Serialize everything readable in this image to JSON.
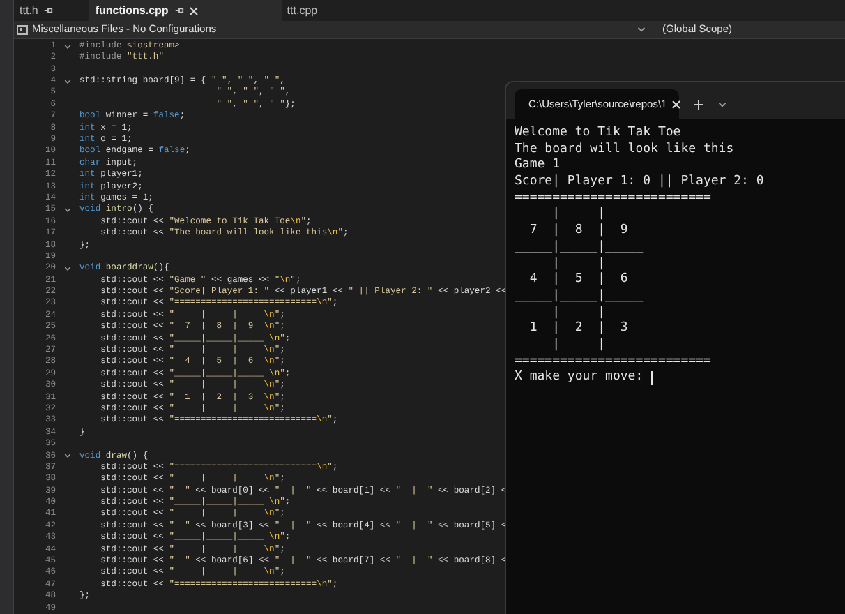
{
  "editor_tabs": [
    {
      "label": "ttt.h",
      "selected": false,
      "pinned": true,
      "closable": false
    },
    {
      "label": "functions.cpp",
      "selected": true,
      "pinned": true,
      "closable": true
    },
    {
      "label": "ttt.cpp",
      "selected": false,
      "pinned": false,
      "closable": false
    }
  ],
  "nav_bar": {
    "project": "Miscellaneous Files - No Configurations",
    "scope": "(Global Scope)"
  },
  "code_lines": [
    {
      "number": "1",
      "fold": true,
      "tokens": [
        {
          "kind": "pp",
          "text": "#include "
        },
        {
          "kind": "str",
          "text": "<iostream>"
        }
      ]
    },
    {
      "number": "2",
      "fold": false,
      "tokens": [
        {
          "kind": "pp",
          "text": "#include "
        },
        {
          "kind": "str",
          "text": "\"ttt.h\""
        }
      ]
    },
    {
      "number": "3",
      "fold": false
    },
    {
      "number": "4",
      "fold": true,
      "tokens": [
        {
          "kind": "plain",
          "text": "std::string board[9] = { "
        },
        {
          "kind": "str",
          "text": "\" \""
        },
        {
          "kind": "plain",
          "text": ", "
        },
        {
          "kind": "str",
          "text": "\" \""
        },
        {
          "kind": "plain",
          "text": ", "
        },
        {
          "kind": "str",
          "text": "\" \""
        },
        {
          "kind": "plain",
          "text": ","
        }
      ]
    },
    {
      "number": "5",
      "fold": false,
      "tokens": [
        {
          "kind": "str",
          "text": "                          \" \""
        },
        {
          "kind": "plain",
          "text": ", "
        },
        {
          "kind": "str",
          "text": "\" \""
        },
        {
          "kind": "plain",
          "text": ", "
        },
        {
          "kind": "str",
          "text": "\" \""
        },
        {
          "kind": "plain",
          "text": ","
        }
      ]
    },
    {
      "number": "6",
      "fold": false,
      "tokens": [
        {
          "kind": "str",
          "text": "                          \" \""
        },
        {
          "kind": "plain",
          "text": ", "
        },
        {
          "kind": "str",
          "text": "\" \""
        },
        {
          "kind": "plain",
          "text": ", "
        },
        {
          "kind": "str",
          "text": "\" \""
        },
        {
          "kind": "plain",
          "text": "};"
        }
      ]
    },
    {
      "number": "7",
      "fold": false,
      "tokens": [
        {
          "kind": "kw",
          "text": "bool"
        },
        {
          "kind": "plain",
          "text": " winner = "
        },
        {
          "kind": "kw",
          "text": "false"
        },
        {
          "kind": "plain",
          "text": ";"
        }
      ]
    },
    {
      "number": "8",
      "fold": false,
      "tokens": [
        {
          "kind": "kw",
          "text": "int"
        },
        {
          "kind": "plain",
          "text": " x = 1;"
        }
      ]
    },
    {
      "number": "9",
      "fold": false,
      "tokens": [
        {
          "kind": "kw",
          "text": "int"
        },
        {
          "kind": "plain",
          "text": " o = 1;"
        }
      ]
    },
    {
      "number": "10",
      "fold": false,
      "tokens": [
        {
          "kind": "kw",
          "text": "bool"
        },
        {
          "kind": "plain",
          "text": " endgame = "
        },
        {
          "kind": "kw",
          "text": "false"
        },
        {
          "kind": "plain",
          "text": ";"
        }
      ]
    },
    {
      "number": "11",
      "fold": false,
      "tokens": [
        {
          "kind": "kw",
          "text": "char"
        },
        {
          "kind": "plain",
          "text": " input;"
        }
      ]
    },
    {
      "number": "12",
      "fold": false,
      "tokens": [
        {
          "kind": "kw",
          "text": "int"
        },
        {
          "kind": "plain",
          "text": " player1;"
        }
      ]
    },
    {
      "number": "13",
      "fold": false,
      "tokens": [
        {
          "kind": "kw",
          "text": "int"
        },
        {
          "kind": "plain",
          "text": " player2;"
        }
      ]
    },
    {
      "number": "14",
      "fold": false,
      "tokens": [
        {
          "kind": "kw",
          "text": "int"
        },
        {
          "kind": "plain",
          "text": " games = 1;"
        }
      ]
    },
    {
      "number": "15",
      "fold": true,
      "tokens": [
        {
          "kind": "kw",
          "text": "void"
        },
        {
          "kind": "fn",
          "text": " intro"
        },
        {
          "kind": "plain",
          "text": "() {"
        }
      ]
    },
    {
      "number": "16",
      "fold": false,
      "tokens": [
        {
          "kind": "plain",
          "text": "    std::cout << "
        },
        {
          "kind": "str",
          "text": "\"Welcome to Tik Tak Toe"
        },
        {
          "kind": "esc",
          "text": "\\n"
        },
        {
          "kind": "str",
          "text": "\""
        },
        {
          "kind": "plain",
          "text": ";"
        }
      ]
    },
    {
      "number": "17",
      "fold": false,
      "tokens": [
        {
          "kind": "plain",
          "text": "    std::cout << "
        },
        {
          "kind": "str",
          "text": "\"The board will look like this"
        },
        {
          "kind": "esc",
          "text": "\\n"
        },
        {
          "kind": "str",
          "text": "\""
        },
        {
          "kind": "plain",
          "text": ";"
        }
      ]
    },
    {
      "number": "18",
      "fold": false,
      "tokens": [
        {
          "kind": "plain",
          "text": "};"
        }
      ]
    },
    {
      "number": "19",
      "fold": false
    },
    {
      "number": "20",
      "fold": true,
      "tokens": [
        {
          "kind": "kw",
          "text": "void"
        },
        {
          "kind": "fn",
          "text": " boarddraw"
        },
        {
          "kind": "plain",
          "text": "(){"
        }
      ]
    },
    {
      "number": "21",
      "fold": false,
      "tokens": [
        {
          "kind": "plain",
          "text": "    std::cout << "
        },
        {
          "kind": "str",
          "text": "\"Game \""
        },
        {
          "kind": "plain",
          "text": " << games << "
        },
        {
          "kind": "str",
          "text": "\""
        },
        {
          "kind": "esc",
          "text": "\\n"
        },
        {
          "kind": "str",
          "text": "\""
        },
        {
          "kind": "plain",
          "text": ";"
        }
      ]
    },
    {
      "number": "22",
      "fold": false,
      "tokens": [
        {
          "kind": "plain",
          "text": "    std::cout << "
        },
        {
          "kind": "str",
          "text": "\"Score| Player 1: \""
        },
        {
          "kind": "plain",
          "text": " << player1 << "
        },
        {
          "kind": "str",
          "text": "\" || Player 2: \""
        },
        {
          "kind": "plain",
          "text": " << player2 <<"
        }
      ]
    },
    {
      "number": "23",
      "fold": false,
      "tokens": [
        {
          "kind": "plain",
          "text": "    std::cout << "
        },
        {
          "kind": "str",
          "text": "\"==========================="
        },
        {
          "kind": "esc",
          "text": "\\n"
        },
        {
          "kind": "str",
          "text": "\""
        },
        {
          "kind": "plain",
          "text": ";"
        }
      ]
    },
    {
      "number": "24",
      "fold": false,
      "tokens": [
        {
          "kind": "plain",
          "text": "    std::cout << "
        },
        {
          "kind": "str",
          "text": "\"     |     |     "
        },
        {
          "kind": "esc",
          "text": "\\n"
        },
        {
          "kind": "str",
          "text": "\""
        },
        {
          "kind": "plain",
          "text": ";"
        }
      ]
    },
    {
      "number": "25",
      "fold": false,
      "tokens": [
        {
          "kind": "plain",
          "text": "    std::cout << "
        },
        {
          "kind": "str",
          "text": "\"  7  |  8  |  9  "
        },
        {
          "kind": "esc",
          "text": "\\n"
        },
        {
          "kind": "str",
          "text": "\""
        },
        {
          "kind": "plain",
          "text": ";"
        }
      ]
    },
    {
      "number": "26",
      "fold": false,
      "tokens": [
        {
          "kind": "plain",
          "text": "    std::cout << "
        },
        {
          "kind": "str",
          "text": "\"_____|_____|_____ "
        },
        {
          "kind": "esc",
          "text": "\\n"
        },
        {
          "kind": "str",
          "text": "\""
        },
        {
          "kind": "plain",
          "text": ";"
        }
      ]
    },
    {
      "number": "27",
      "fold": false,
      "tokens": [
        {
          "kind": "plain",
          "text": "    std::cout << "
        },
        {
          "kind": "str",
          "text": "\"     |     |     "
        },
        {
          "kind": "esc",
          "text": "\\n"
        },
        {
          "kind": "str",
          "text": "\""
        },
        {
          "kind": "plain",
          "text": ";"
        }
      ]
    },
    {
      "number": "28",
      "fold": false,
      "tokens": [
        {
          "kind": "plain",
          "text": "    std::cout << "
        },
        {
          "kind": "str",
          "text": "\"  4  |  5  |  6  "
        },
        {
          "kind": "esc",
          "text": "\\n"
        },
        {
          "kind": "str",
          "text": "\""
        },
        {
          "kind": "plain",
          "text": ";"
        }
      ]
    },
    {
      "number": "29",
      "fold": false,
      "tokens": [
        {
          "kind": "plain",
          "text": "    std::cout << "
        },
        {
          "kind": "str",
          "text": "\"_____|_____|_____ "
        },
        {
          "kind": "esc",
          "text": "\\n"
        },
        {
          "kind": "str",
          "text": "\""
        },
        {
          "kind": "plain",
          "text": ";"
        }
      ]
    },
    {
      "number": "30",
      "fold": false,
      "tokens": [
        {
          "kind": "plain",
          "text": "    std::cout << "
        },
        {
          "kind": "str",
          "text": "\"     |     |     "
        },
        {
          "kind": "esc",
          "text": "\\n"
        },
        {
          "kind": "str",
          "text": "\""
        },
        {
          "kind": "plain",
          "text": ";"
        }
      ]
    },
    {
      "number": "31",
      "fold": false,
      "tokens": [
        {
          "kind": "plain",
          "text": "    std::cout << "
        },
        {
          "kind": "str",
          "text": "\"  1  |  2  |  3  "
        },
        {
          "kind": "esc",
          "text": "\\n"
        },
        {
          "kind": "str",
          "text": "\""
        },
        {
          "kind": "plain",
          "text": ";"
        }
      ]
    },
    {
      "number": "32",
      "fold": false,
      "tokens": [
        {
          "kind": "plain",
          "text": "    std::cout << "
        },
        {
          "kind": "str",
          "text": "\"     |     |     "
        },
        {
          "kind": "esc",
          "text": "\\n"
        },
        {
          "kind": "str",
          "text": "\""
        },
        {
          "kind": "plain",
          "text": ";"
        }
      ]
    },
    {
      "number": "33",
      "fold": false,
      "tokens": [
        {
          "kind": "plain",
          "text": "    std::cout << "
        },
        {
          "kind": "str",
          "text": "\"==========================="
        },
        {
          "kind": "esc",
          "text": "\\n"
        },
        {
          "kind": "str",
          "text": "\""
        },
        {
          "kind": "plain",
          "text": ";"
        }
      ]
    },
    {
      "number": "34",
      "fold": false,
      "tokens": [
        {
          "kind": "plain",
          "text": "}"
        }
      ]
    },
    {
      "number": "35",
      "fold": false
    },
    {
      "number": "36",
      "fold": true,
      "tokens": [
        {
          "kind": "kw",
          "text": "void"
        },
        {
          "kind": "fn",
          "text": " draw"
        },
        {
          "kind": "plain",
          "text": "() {"
        }
      ]
    },
    {
      "number": "37",
      "fold": false,
      "tokens": [
        {
          "kind": "plain",
          "text": "    std::cout << "
        },
        {
          "kind": "str",
          "text": "\"==========================="
        },
        {
          "kind": "esc",
          "text": "\\n"
        },
        {
          "kind": "str",
          "text": "\""
        },
        {
          "kind": "plain",
          "text": ";"
        }
      ]
    },
    {
      "number": "38",
      "fold": false,
      "tokens": [
        {
          "kind": "plain",
          "text": "    std::cout << "
        },
        {
          "kind": "str",
          "text": "\"     |     |     "
        },
        {
          "kind": "esc",
          "text": "\\n"
        },
        {
          "kind": "str",
          "text": "\""
        },
        {
          "kind": "plain",
          "text": ";"
        }
      ]
    },
    {
      "number": "39",
      "fold": false,
      "tokens": [
        {
          "kind": "plain",
          "text": "    std::cout << "
        },
        {
          "kind": "str",
          "text": "\"  \""
        },
        {
          "kind": "plain",
          "text": " << board[0] << "
        },
        {
          "kind": "str",
          "text": "\"  |  \""
        },
        {
          "kind": "plain",
          "text": " << board[1] << "
        },
        {
          "kind": "str",
          "text": "\"  |  \""
        },
        {
          "kind": "plain",
          "text": " << board[2] <"
        }
      ]
    },
    {
      "number": "40",
      "fold": false,
      "tokens": [
        {
          "kind": "plain",
          "text": "    std::cout << "
        },
        {
          "kind": "str",
          "text": "\"_____|_____|_____ "
        },
        {
          "kind": "esc",
          "text": "\\n"
        },
        {
          "kind": "str",
          "text": "\""
        },
        {
          "kind": "plain",
          "text": ";"
        }
      ]
    },
    {
      "number": "41",
      "fold": false,
      "tokens": [
        {
          "kind": "plain",
          "text": "    std::cout << "
        },
        {
          "kind": "str",
          "text": "\"     |     |     "
        },
        {
          "kind": "esc",
          "text": "\\n"
        },
        {
          "kind": "str",
          "text": "\""
        },
        {
          "kind": "plain",
          "text": ";"
        }
      ]
    },
    {
      "number": "42",
      "fold": false,
      "tokens": [
        {
          "kind": "plain",
          "text": "    std::cout << "
        },
        {
          "kind": "str",
          "text": "\"  \""
        },
        {
          "kind": "plain",
          "text": " << board[3] << "
        },
        {
          "kind": "str",
          "text": "\"  |  \""
        },
        {
          "kind": "plain",
          "text": " << board[4] << "
        },
        {
          "kind": "str",
          "text": "\"  |  \""
        },
        {
          "kind": "plain",
          "text": " << board[5] <"
        }
      ]
    },
    {
      "number": "43",
      "fold": false,
      "tokens": [
        {
          "kind": "plain",
          "text": "    std::cout << "
        },
        {
          "kind": "str",
          "text": "\"_____|_____|_____ "
        },
        {
          "kind": "esc",
          "text": "\\n"
        },
        {
          "kind": "str",
          "text": "\""
        },
        {
          "kind": "plain",
          "text": ";"
        }
      ]
    },
    {
      "number": "44",
      "fold": false,
      "tokens": [
        {
          "kind": "plain",
          "text": "    std::cout << "
        },
        {
          "kind": "str",
          "text": "\"     |     |     "
        },
        {
          "kind": "esc",
          "text": "\\n"
        },
        {
          "kind": "str",
          "text": "\""
        },
        {
          "kind": "plain",
          "text": ";"
        }
      ]
    },
    {
      "number": "45",
      "fold": false,
      "tokens": [
        {
          "kind": "plain",
          "text": "    std::cout << "
        },
        {
          "kind": "str",
          "text": "\"  \""
        },
        {
          "kind": "plain",
          "text": " << board[6] << "
        },
        {
          "kind": "str",
          "text": "\"  |  \""
        },
        {
          "kind": "plain",
          "text": " << board[7] << "
        },
        {
          "kind": "str",
          "text": "\"  |  \""
        },
        {
          "kind": "plain",
          "text": " << board[8] <"
        }
      ]
    },
    {
      "number": "46",
      "fold": false,
      "tokens": [
        {
          "kind": "plain",
          "text": "    std::cout << "
        },
        {
          "kind": "str",
          "text": "\"     |     |     "
        },
        {
          "kind": "esc",
          "text": "\\n"
        },
        {
          "kind": "str",
          "text": "\""
        },
        {
          "kind": "plain",
          "text": ";"
        }
      ]
    },
    {
      "number": "47",
      "fold": false,
      "tokens": [
        {
          "kind": "plain",
          "text": "    std::cout << "
        },
        {
          "kind": "str",
          "text": "\"==========================="
        },
        {
          "kind": "esc",
          "text": "\\n"
        },
        {
          "kind": "str",
          "text": "\""
        },
        {
          "kind": "plain",
          "text": ";"
        }
      ]
    },
    {
      "number": "48",
      "fold": false,
      "tokens": [
        {
          "kind": "plain",
          "text": "};"
        }
      ]
    },
    {
      "number": "49",
      "fold": false
    }
  ],
  "terminal": {
    "tab_title": "C:\\Users\\Tyler\\source\\repos\\1",
    "lines": [
      {
        "kind": "output",
        "text": "Welcome to Tik Tak Toe"
      },
      {
        "kind": "output",
        "text": "The board will look like this"
      },
      {
        "kind": "output",
        "text": "Game 1"
      },
      {
        "kind": "output",
        "text": "Score| Player 1: 0 || Player 2: 0"
      },
      {
        "kind": "output",
        "text": "=========================="
      },
      {
        "kind": "output",
        "text": "     |     |"
      },
      {
        "kind": "output",
        "text": "  7  |  8  |  9"
      },
      {
        "kind": "output",
        "text": "_____|_____|_____"
      },
      {
        "kind": "output",
        "text": "     |     |"
      },
      {
        "kind": "output",
        "text": "  4  |  5  |  6"
      },
      {
        "kind": "output",
        "text": "_____|_____|_____"
      },
      {
        "kind": "output",
        "text": "     |     |"
      },
      {
        "kind": "output",
        "text": "  1  |  2  |  3"
      },
      {
        "kind": "output",
        "text": "     |     |"
      },
      {
        "kind": "output",
        "text": "=========================="
      },
      {
        "kind": "prompt",
        "text": "X make your move: "
      }
    ]
  }
}
